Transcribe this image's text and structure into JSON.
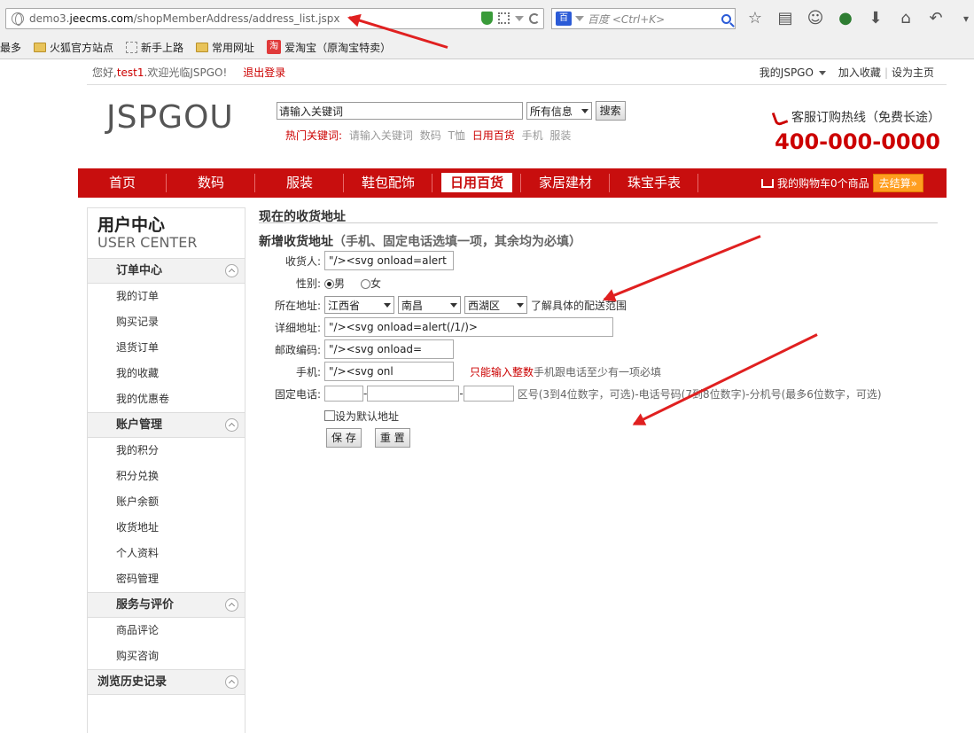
{
  "browser": {
    "url_prefix": "demo3.",
    "url_domain": "jeecms.com",
    "url_path": "/shopMemberAddress/address_list.jspx",
    "search_engine_icon": "百",
    "search_placeholder": "百度 <Ctrl+K>",
    "toolbar_icons": [
      "☆",
      "▤",
      "☺",
      "●",
      "⬇",
      "⌂",
      "↶",
      "▾"
    ],
    "bookmarks": [
      {
        "label": "最多",
        "icon": "none"
      },
      {
        "label": "火狐官方站点",
        "icon": "folder"
      },
      {
        "label": "新手上路",
        "icon": "dashed"
      },
      {
        "label": "常用网址",
        "icon": "folder"
      },
      {
        "label": "爱淘宝（原淘宝特卖）",
        "icon": "taobao"
      }
    ],
    "taobao_icon_text": "淘"
  },
  "topbar": {
    "greeting_pre": "您好,",
    "username": "test1",
    "greeting_post": ".欢迎光临JSPGO!",
    "logout": "退出登录",
    "my_jspgo": "我的JSPGO",
    "add_favorite": "加入收藏",
    "set_home": "设为主页"
  },
  "header": {
    "logo": "JSPGOU",
    "search_input": "请输入关键词",
    "search_scope": "所有信息",
    "search_button": "搜索",
    "hot_label": "热门关键词:",
    "hot_keywords": [
      "请输入关键词",
      "数码",
      "T恤",
      "日用百货",
      "手机",
      "服装"
    ],
    "hotline_label": "客服订购热线（免费长途）",
    "hotline_number": "400-000-0000"
  },
  "nav": {
    "items": [
      "首页",
      "数码",
      "服装",
      "鞋包配饰",
      "日用百货",
      "家居建材",
      "珠宝手表"
    ],
    "active_index": 4,
    "cart_text": "我的购物车0个商品",
    "checkout": "去结算»"
  },
  "sidebar": {
    "title_cn": "用户中心",
    "title_en": "USER CENTER",
    "sections": [
      {
        "title": "订单中心",
        "links": [
          "我的订单",
          "购买记录",
          "退货订单",
          "我的收藏",
          "我的优惠卷"
        ]
      },
      {
        "title": "账户管理",
        "links": [
          "我的积分",
          "积分兑换",
          "账户余额",
          "收货地址",
          "个人资料",
          "密码管理"
        ]
      },
      {
        "title": "服务与评价",
        "links": [
          "商品评论",
          "购买咨询"
        ]
      }
    ],
    "history": "浏览历史记录"
  },
  "main": {
    "title": "现在的收货地址",
    "subtitle": "新增收货地址",
    "subtitle_note": "（手机、固定电话选填一项，其余均为必填）",
    "form": {
      "receiver_label": "收货人:",
      "receiver_value": "\"/><svg onload=alert",
      "gender_label": "性别:",
      "gender_male": "男",
      "gender_female": "女",
      "gender_selected": "male",
      "region_label": "所在地址:",
      "province": "江西省",
      "city": "南昌",
      "district": "西湖区",
      "region_link": "了解具体的配送范围",
      "detail_label": "详细地址:",
      "detail_value": "\"/><svg onload=alert(/1/)>",
      "zip_label": "邮政编码:",
      "zip_value": "\"/><svg onload=",
      "mobile_label": "手机:",
      "mobile_value": "\"/><svg onl",
      "mobile_hint_red": "只能输入整数",
      "mobile_hint": "手机跟电话至少有一项必填",
      "tel_label": "固定电话:",
      "tel_sep": "-",
      "tel_hint": "区号(3到4位数字，可选)-电话号码(7到8位数字)-分机号(最多6位数字，可选)",
      "default_label": "设为默认地址",
      "save": "保 存",
      "reset": "重 置"
    }
  }
}
